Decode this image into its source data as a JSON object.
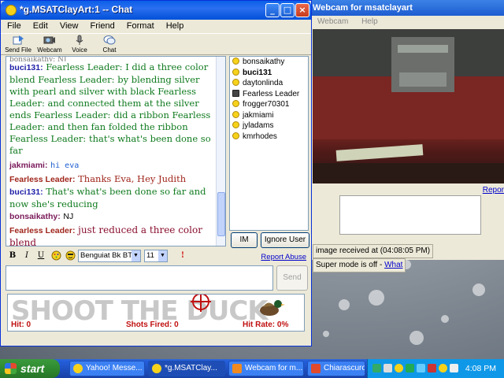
{
  "chat_window": {
    "title": "*g.MSATClayArt:1 -- Chat",
    "menu": [
      "File",
      "Edit",
      "View",
      "Friend",
      "Format",
      "Help"
    ],
    "toolbar": [
      "Send File",
      "Webcam",
      "Voice",
      "Chat"
    ],
    "messages": [
      {
        "nick": "buci131:",
        "text": "Fearless Leader: I did a three color blend Fearless Leader: by blending silver with pearl and silver with black Fearless Leader: and connected them at the silver ends Fearless Leader: did a ribbon Fearless Leader: and then fan folded the ribbon Fearless Leader: that's what's been done so far"
      },
      {
        "nick": "jakmiami:",
        "text": "hi eva"
      },
      {
        "nick": "Fearless Leader:",
        "text": "Thanks Eva, Hey Judith"
      },
      {
        "nick": "buci131:",
        "text": "That's what's been done so far and now she's reducing"
      },
      {
        "nick": "bonsaikathy:",
        "text": "NJ"
      },
      {
        "nick": "Fearless Leader:",
        "text": "just reduced a three color blend"
      }
    ],
    "users": [
      "bonsaikathy",
      "buci131",
      "daytonlinda",
      "Fearless Leader",
      "frogger70301",
      "jakmiami",
      "jyladams",
      "kmrhodes"
    ],
    "im_button": "IM",
    "ignore_button": "Ignore User",
    "format": {
      "bold": "B",
      "italic": "I",
      "underline": "U",
      "font": "Benguiat Bk BT",
      "size": "11"
    },
    "report_abuse": "Report Abuse",
    "send_button": "Send",
    "ad": {
      "title": "SHOOT THE DUCK",
      "hit": "Hit: 0",
      "shots": "Shots Fired: 0",
      "rate": "Hit Rate: 0%"
    }
  },
  "webcam_window": {
    "title": "Webcam for msatclayart",
    "menu": [
      "Webcam",
      "Help"
    ],
    "report_link": "Repor",
    "status_image": "image received at (04:08:05 PM)",
    "status_mode": "Super mode is off -",
    "status_link": "What"
  },
  "taskbar": {
    "start": "start",
    "tasks": [
      "Yahoo! Messe...",
      "*g.MSATClay...",
      "Webcam for m...",
      "Chiarascuro1 ..."
    ],
    "clock": "4:08 PM"
  }
}
